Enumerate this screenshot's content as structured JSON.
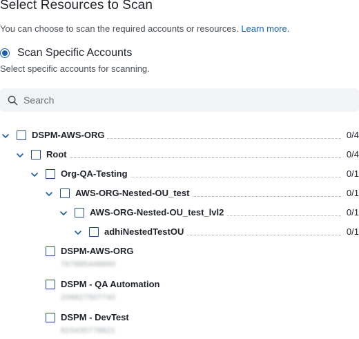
{
  "header": {
    "title": "Select Resources to Scan",
    "description": "You can choose to scan the required accounts or resources.",
    "learn_more": "Learn more."
  },
  "scan_option": {
    "label": "Scan Specific Accounts",
    "sublabel": "Select specific accounts for scanning.",
    "selected": true
  },
  "search": {
    "placeholder": "Search",
    "value": ""
  },
  "tree": [
    {
      "label": "DSPM-AWS-ORG",
      "count": "0/4",
      "expanded": true,
      "checked": false
    },
    {
      "label": "Root",
      "count": "0/4",
      "expanded": true,
      "checked": false
    },
    {
      "label": "Org-QA-Testing",
      "count": "0/1",
      "expanded": true,
      "checked": false
    },
    {
      "label": "AWS-ORG-Nested-OU_test",
      "count": "0/1",
      "expanded": true,
      "checked": false
    },
    {
      "label": "AWS-ORG-Nested-OU_test_lvl2",
      "count": "0/1",
      "expanded": true,
      "checked": false
    },
    {
      "label": "adhiNestedTestOU",
      "count": "0/1",
      "expanded": true,
      "checked": false
    }
  ],
  "accounts": [
    {
      "label": "DSPM-AWS-ORG",
      "account_id": "767885448890",
      "checked": false
    },
    {
      "label": "DSPM - QA Automation",
      "account_id": "208827507740",
      "checked": false
    },
    {
      "label": "DSPM - DevTest",
      "account_id": "823435778821",
      "checked": false
    }
  ],
  "colors": {
    "accent": "#1a5fb4",
    "link": "#1565c0",
    "checkbox_border": "#1f4d99",
    "search_bg": "#f1f3f5"
  },
  "icons": {
    "search": "search-icon",
    "expand": "chevron-down-icon"
  }
}
